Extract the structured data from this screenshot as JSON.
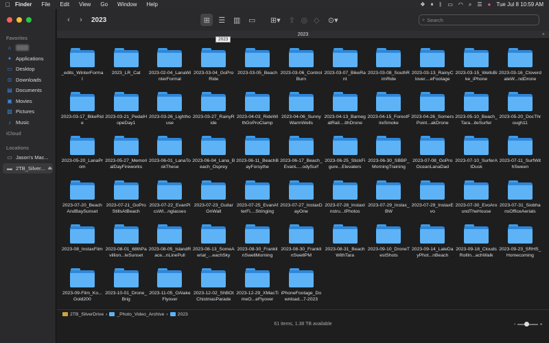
{
  "menubar": {
    "app": "Finder",
    "items": [
      "File",
      "Edit",
      "View",
      "Go",
      "Window",
      "Help"
    ],
    "clock": "Tue Jul 8  10:59 AM"
  },
  "sidebar": {
    "favorites_header": "Favorites",
    "favorites": [
      {
        "label": "home",
        "icon": "home-icon",
        "blurred": true
      },
      {
        "label": "Applications",
        "icon": "applications-icon"
      },
      {
        "label": "Desktop",
        "icon": "desktop-icon"
      },
      {
        "label": "Downloads",
        "icon": "downloads-icon"
      },
      {
        "label": "Documents",
        "icon": "documents-icon"
      },
      {
        "label": "Movies",
        "icon": "movies-icon"
      },
      {
        "label": "Pictures",
        "icon": "pictures-icon"
      },
      {
        "label": "Music",
        "icon": "music-icon"
      }
    ],
    "icloud_header": "iCloud",
    "locations_header": "Locations",
    "locations": [
      {
        "label": "Jason's Mac...",
        "icon": "laptop-icon"
      },
      {
        "label": "2TB_Silver...",
        "icon": "drive-icon",
        "eject": true
      }
    ]
  },
  "toolbar": {
    "title": "2023",
    "search_placeholder": "Search",
    "tab_title": "2023",
    "tooltip": "2023"
  },
  "folders": [
    "_edits_WinterFormal",
    "2023_LR_Cat",
    "2023-02-04_LanaWinterFormal",
    "2023-03-04_GoProRide",
    "2023-03-05_Beach",
    "2023-03-06_ControlBurn",
    "2023-03-07_BikeRant",
    "2023-03-08_SouthRimRide",
    "2023-03-13_RainyClover....eFootage",
    "2023-03-15_WellsBike_iPhone",
    "2023-03-16_CloverdaleW...ndDrone",
    "2023-03-17_BikeRide",
    "2023-03-21_PedalHopeDay1",
    "2023-03-26_Lighthouse",
    "2023-03-27_RainyRide",
    "2023-04-03_RideWithGoProClamp",
    "2023-04-06_SunnyWarmWells",
    "2023-04-13_BarnegatRail....ithDrone",
    "2023-04-15_ForestFireSmoke",
    "2023-04-26_SomersPoint...akDrone",
    "2023-05-10_Beach_Tara...iteSurfer",
    "2023-05-20_DocThrough11",
    "2023-05-20_LanaProm",
    "2023-05-27_MemorialDayFireworks",
    "2023-06-01_LanaTookThese",
    "2023-06-04_Lana_Beach_Osprey",
    "2023-06-11_BeachBayForsythe",
    "2023-06-17_Beach_EvanL....odySurf",
    "2023-06-25_StickFigure...Elevaters",
    "2023-06-30_SBBP_MorningTraining",
    "2023-07-08_GoProOceanLanaDad",
    "2023-07-10_SurferAtDusk",
    "2023-07-11_SurfWithSween",
    "2023-07-20_BeachAndBaySunset",
    "2023-07-21_GoProStillsAtBeach",
    "2023-07-22_EvanPicsWi...nglasses",
    "2023-07-23_GuitarOnWall",
    "2023-07-25_EvanAfterFi....Stringing",
    "2023-07-27_InstaxDayOne",
    "2023-07-28_InstaxInstru...tPhotos",
    "2023-07-29_Instax_BW",
    "2023-07-29_InstaxEvo",
    "2023-07-30_EvoAroundTheHouse",
    "2023-07-31_SiobhansOfficeAerials",
    "2023-08_InstaxFilm",
    "2023-08-01_68thPavillion...leSunset",
    "2023-08-05_IslandRace...nLinePull",
    "2023-08-13_SomeAerial_...eachSky",
    "2023-08-30_FranklinSwellMorning",
    "2023-08-30_FranklinSwellPM",
    "2023-08-31_BeachWithTara",
    "2023-09-10_DroneTestShots",
    "2023-09-14_LateDayPhot...nBeach",
    "2023-09-18_CloudsRollIn...achWalk",
    "2023-09-23_SRHS_Homecoming",
    "2023-09-Film_Ko...Gold200",
    "2023-10-01_Drone_Brig",
    "2023-11-05_OAlakeFlyover",
    "2023-12-02_ShBOtChistmasParade",
    "2023-12-29_XMasTimeO...eFlyover",
    "iPhoneFootage_Download...7-2023"
  ],
  "breadcrumb": [
    "2TB_SilverDrive",
    "_Photo_Video_Archive",
    "2023"
  ],
  "status": "61 items, 1.38 TB available",
  "colors": {
    "folder": "#5db3f5",
    "accent": "#3a8ee6"
  }
}
